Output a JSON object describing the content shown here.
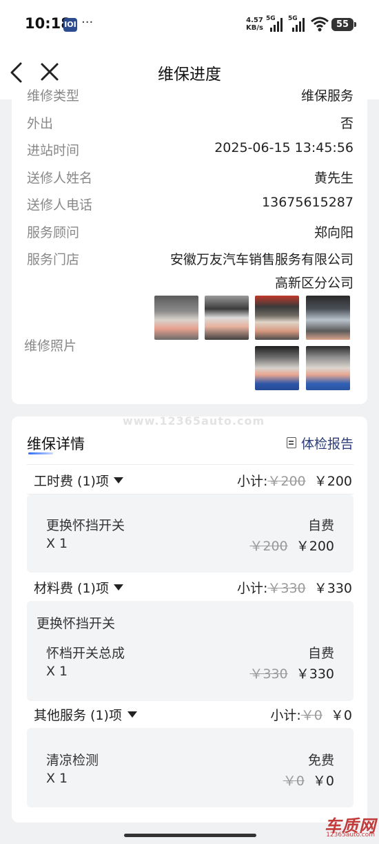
{
  "status_bar": {
    "time": "10:18",
    "app_icon": "IOI",
    "more": "···",
    "speed_value": "4.57",
    "speed_unit": "KB/s",
    "net1": "5G",
    "net2": "5G",
    "battery": "55"
  },
  "header": {
    "title": "维保进度"
  },
  "info": {
    "cut_row": {
      "label": "维修类型",
      "value": "维保服务"
    },
    "rows": [
      {
        "label": "外出",
        "value": "否"
      },
      {
        "label": "进站时间",
        "value": "2025-06-15 13:45:56"
      },
      {
        "label": "送修人姓名",
        "value": "黄先生"
      },
      {
        "label": "送修人电话",
        "value": "13675615287"
      },
      {
        "label": "服务顾问",
        "value": "郑向阳"
      }
    ],
    "store": {
      "label": "服务门店",
      "line1": "安徽万友汽车销售服务有限公司",
      "line2": "高新区分公司"
    },
    "photos_label": "维修照片"
  },
  "watermark": "www.12365auto.com",
  "detail": {
    "title": "维保详情",
    "report_link": "体检报告",
    "labor": {
      "name": "工时费 (1)项",
      "subtotal_label": "小计:",
      "subtotal_original": "￥200",
      "subtotal": "￥200",
      "item": {
        "name": "更换怀挡开关",
        "pay": "自费",
        "qty": "X 1",
        "original": "￥200",
        "price": "￥200"
      }
    },
    "material": {
      "name": "材料费 (1)项",
      "subtotal_label": "小计:",
      "subtotal_original": "￥330",
      "subtotal": "￥330",
      "package": "更换怀挡开关",
      "item": {
        "name": "怀档开关总成",
        "pay": "自费",
        "qty": "X 1",
        "original": "￥330",
        "price": "￥330"
      }
    },
    "other": {
      "name": "其他服务 (1)项",
      "subtotal_label": "小计:",
      "subtotal_original": "￥0",
      "subtotal": "￥0",
      "item": {
        "name": "清凉检测",
        "pay": "免费",
        "qty": "X 1",
        "original": "￥0",
        "price": "￥0"
      }
    }
  },
  "logo": {
    "big": "车质网",
    "small": "12365auto.com"
  },
  "colors": {
    "link": "#2c3e7a",
    "muted": "#888888",
    "page_bg": "#f0f1f3"
  }
}
